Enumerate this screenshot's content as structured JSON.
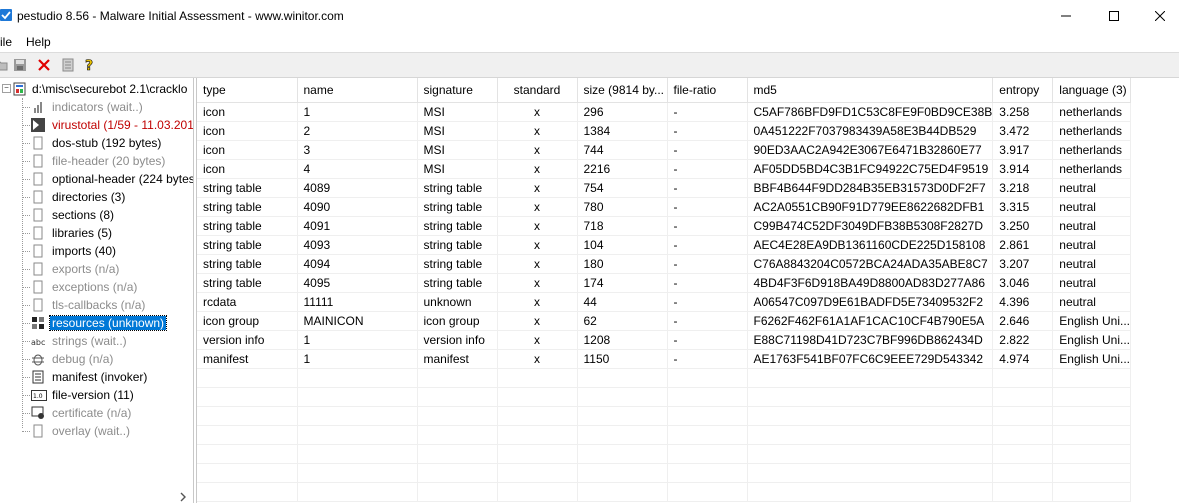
{
  "window": {
    "title": "pestudio 8.56 - Malware Initial Assessment - www.winitor.com"
  },
  "menu": {
    "items": [
      "ile",
      "Help"
    ]
  },
  "tree": {
    "root_label": "d:\\misc\\securebot 2.1\\cracklo",
    "items": [
      {
        "label": "indicators (wait..)",
        "style": "grey",
        "icon": "indicators-icon"
      },
      {
        "label": "virustotal (1/59 - 11.03.201",
        "style": "red",
        "icon": "virustotal-icon"
      },
      {
        "label": "dos-stub (192 bytes)",
        "style": "normal",
        "icon": "page-icon"
      },
      {
        "label": "file-header (20 bytes)",
        "style": "grey",
        "icon": "page-icon"
      },
      {
        "label": "optional-header (224 bytes",
        "style": "normal",
        "icon": "page-icon"
      },
      {
        "label": "directories (3)",
        "style": "normal",
        "icon": "page-icon"
      },
      {
        "label": "sections (8)",
        "style": "normal",
        "icon": "page-icon"
      },
      {
        "label": "libraries (5)",
        "style": "normal",
        "icon": "page-icon"
      },
      {
        "label": "imports (40)",
        "style": "normal",
        "icon": "page-icon"
      },
      {
        "label": "exports (n/a)",
        "style": "grey",
        "icon": "page-icon"
      },
      {
        "label": "exceptions (n/a)",
        "style": "grey",
        "icon": "page-icon"
      },
      {
        "label": "tls-callbacks (n/a)",
        "style": "grey",
        "icon": "page-icon"
      },
      {
        "label": "resources (unknown)",
        "style": "selected",
        "icon": "resources-icon"
      },
      {
        "label": "strings (wait..)",
        "style": "grey",
        "icon": "strings-icon"
      },
      {
        "label": "debug (n/a)",
        "style": "grey",
        "icon": "debug-icon"
      },
      {
        "label": "manifest (invoker)",
        "style": "normal",
        "icon": "manifest-icon"
      },
      {
        "label": "file-version (11)",
        "style": "normal",
        "icon": "file-version-icon"
      },
      {
        "label": "certificate (n/a)",
        "style": "grey",
        "icon": "certificate-icon"
      },
      {
        "label": "overlay (wait..)",
        "style": "grey",
        "icon": "page-icon"
      }
    ]
  },
  "table": {
    "columns": [
      "type",
      "name",
      "signature",
      "standard",
      "size (9814 by...",
      "file-ratio",
      "md5",
      "entropy",
      "language (3)"
    ],
    "rows": [
      [
        "icon",
        "1",
        "MSI",
        "x",
        "296",
        "-",
        "C5AF786BFD9FD1C53C8FE9F0BD9CE38B",
        "3.258",
        "netherlands"
      ],
      [
        "icon",
        "2",
        "MSI",
        "x",
        "1384",
        "-",
        "0A451222F7037983439A58E3B44DB529",
        "3.472",
        "netherlands"
      ],
      [
        "icon",
        "3",
        "MSI",
        "x",
        "744",
        "-",
        "90ED3AAC2A942E3067E6471B32860E77",
        "3.917",
        "netherlands"
      ],
      [
        "icon",
        "4",
        "MSI",
        "x",
        "2216",
        "-",
        "AF05DD5BD4C3B1FC94922C75ED4F9519",
        "3.914",
        "netherlands"
      ],
      [
        "string table",
        "4089",
        "string table",
        "x",
        "754",
        "-",
        "BBF4B644F9DD284B35EB31573D0DF2F7",
        "3.218",
        "neutral"
      ],
      [
        "string table",
        "4090",
        "string table",
        "x",
        "780",
        "-",
        "AC2A0551CB90F91D779EE8622682DFB1",
        "3.315",
        "neutral"
      ],
      [
        "string table",
        "4091",
        "string table",
        "x",
        "718",
        "-",
        "C99B474C52DF3049DFB38B5308F2827D",
        "3.250",
        "neutral"
      ],
      [
        "string table",
        "4093",
        "string table",
        "x",
        "104",
        "-",
        "AEC4E28EA9DB1361160CDE225D158108",
        "2.861",
        "neutral"
      ],
      [
        "string table",
        "4094",
        "string table",
        "x",
        "180",
        "-",
        "C76A8843204C0572BCA24ADA35ABE8C7",
        "3.207",
        "neutral"
      ],
      [
        "string table",
        "4095",
        "string table",
        "x",
        "174",
        "-",
        "4BD4F3F6D918BA49D8800AD83D277A86",
        "3.046",
        "neutral"
      ],
      [
        "rcdata",
        "11111",
        "unknown",
        "x",
        "44",
        "-",
        "A06547C097D9E61BADFD5E73409532F2",
        "4.396",
        "neutral"
      ],
      [
        "icon group",
        "MAINICON",
        "icon group",
        "x",
        "62",
        "-",
        "F6262F462F61A1AF1CAC10CF4B790E5A",
        "2.646",
        "English Uni..."
      ],
      [
        "version info",
        "1",
        "version info",
        "x",
        "1208",
        "-",
        "E88C71198D41D723C7BF996DB862434D",
        "2.822",
        "English Uni..."
      ],
      [
        "manifest",
        "1",
        "manifest",
        "x",
        "1150",
        "-",
        "AE1763F541BF07FC6C9EEE729D543342",
        "4.974",
        "English Uni..."
      ]
    ]
  },
  "colors": {
    "selection": "#0078d7",
    "warning_text": "#c00000",
    "disabled_text": "#8c8c8c"
  }
}
